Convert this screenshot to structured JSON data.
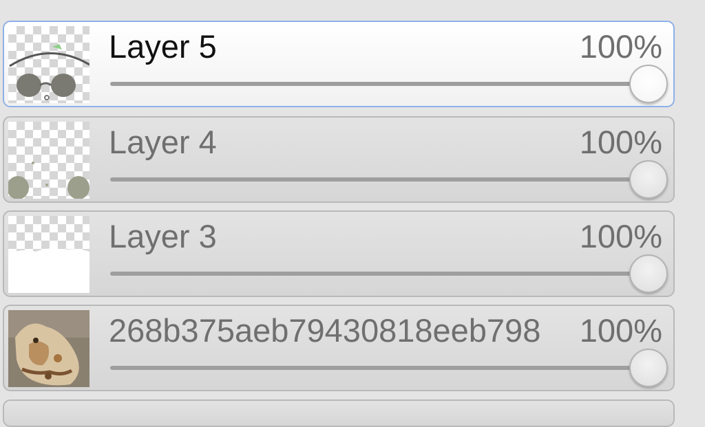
{
  "layers": [
    {
      "name": "Layer 5",
      "opacity_label": "100%",
      "opacity": 100,
      "selected": true,
      "thumbnail": "layer-5-thumbnail"
    },
    {
      "name": "Layer 4",
      "opacity_label": "100%",
      "opacity": 100,
      "selected": false,
      "thumbnail": "layer-4-thumbnail"
    },
    {
      "name": "Layer 3",
      "opacity_label": "100%",
      "opacity": 100,
      "selected": false,
      "thumbnail": "layer-3-thumbnail"
    },
    {
      "name": "268b375aeb79430818eeb798",
      "opacity_label": "100%",
      "opacity": 100,
      "selected": false,
      "thumbnail": "photo-thumbnail"
    }
  ],
  "colors": {
    "selected_border": "#8fb0e8",
    "panel_background": "#e4e4e4"
  }
}
